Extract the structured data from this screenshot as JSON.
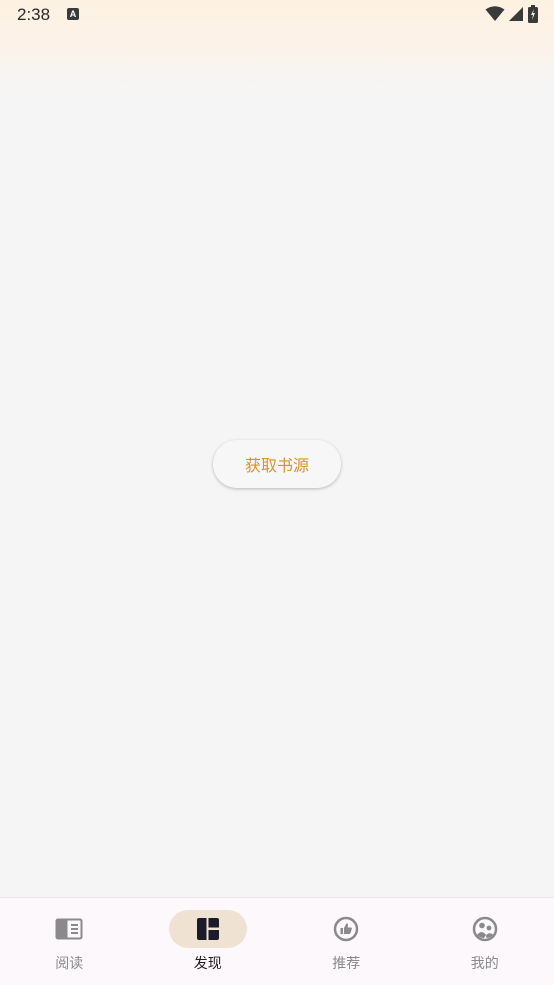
{
  "status_bar": {
    "time": "2:38",
    "notification_glyph": "A",
    "icons": [
      "wifi-icon",
      "cell-signal-icon",
      "battery-icon"
    ]
  },
  "main": {
    "action_label": "获取书源",
    "action_color": "#d9932a"
  },
  "bottom_nav": {
    "active_index": 1,
    "items": [
      {
        "label": "阅读",
        "icon": "book-icon"
      },
      {
        "label": "发现",
        "icon": "dashboard-icon"
      },
      {
        "label": "推荐",
        "icon": "like-icon"
      },
      {
        "label": "我的",
        "icon": "profile-icon"
      }
    ]
  },
  "colors": {
    "background": "#f5f5f5",
    "accent": "#d9932a",
    "active_pill": "#efe2d3"
  }
}
